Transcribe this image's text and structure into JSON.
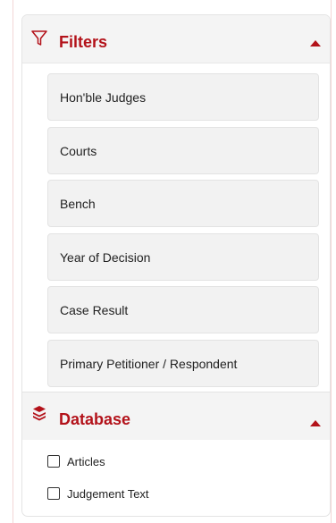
{
  "filters": {
    "title": "Filters",
    "icon": "funnel-outline-icon",
    "accent": "#b3121a",
    "items": [
      {
        "label": "Hon'ble Judges"
      },
      {
        "label": "Courts"
      },
      {
        "label": "Bench"
      },
      {
        "label": "Year of Decision"
      },
      {
        "label": "Case Result"
      },
      {
        "label": "Primary Petitioner / Respondent"
      }
    ]
  },
  "database": {
    "title": "Database",
    "icon": "layers-icon",
    "options": [
      {
        "label": "Articles",
        "checked": false
      },
      {
        "label": "Judgement Text",
        "checked": false
      }
    ]
  }
}
